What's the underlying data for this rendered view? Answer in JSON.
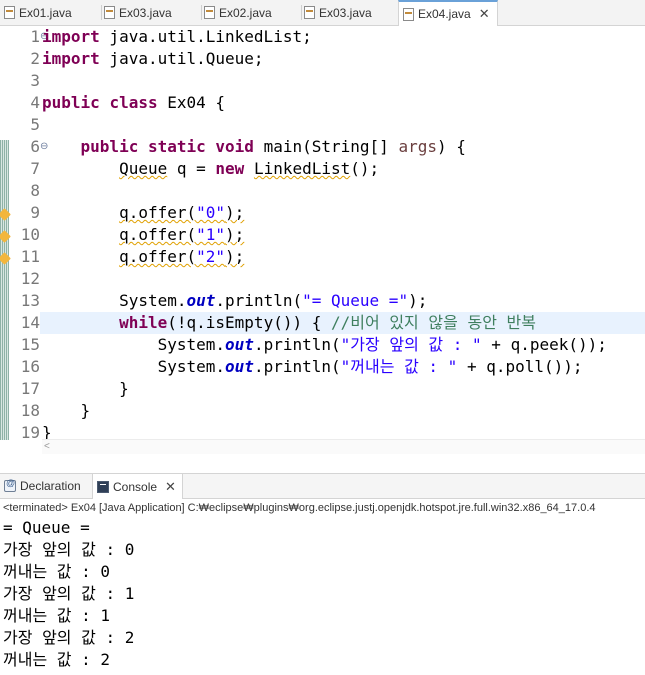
{
  "tabs": [
    {
      "label": "Ex01.java",
      "active": false
    },
    {
      "label": "Ex03.java",
      "active": false
    },
    {
      "label": "Ex02.java",
      "active": false
    },
    {
      "label": "Ex03.java",
      "active": false
    },
    {
      "label": "Ex04.java",
      "active": true
    }
  ],
  "close_glyph": "✕",
  "editor": {
    "line_numbers": [
      "1",
      "2",
      "3",
      "4",
      "5",
      "6",
      "7",
      "8",
      "9",
      "10",
      "11",
      "12",
      "13",
      "14",
      "15",
      "16",
      "17",
      "18",
      "19"
    ],
    "code": {
      "l1_kw": "import",
      "l1_rest": " java.util.LinkedList;",
      "l2_kw": "import",
      "l2_rest": " java.util.Queue;",
      "l4_kw1": "public",
      "l4_kw2": "class",
      "l4_rest": " Ex04 {",
      "l6_kw1": "public",
      "l6_kw2": "static",
      "l6_kw3": "void",
      "l6_a": " main(String[] ",
      "l6_param": "args",
      "l6_b": ") {",
      "l7_type": "Queue",
      "l7_a": " q = ",
      "l7_kw": "new",
      "l7_b": " ",
      "l7_type2": "LinkedList",
      "l7_c": "();",
      "l9_a": "q.offer(",
      "l9_str": "\"0\"",
      "l9_b": ");",
      "l10_a": "q.offer(",
      "l10_str": "\"1\"",
      "l10_b": ");",
      "l11_a": "q.offer(",
      "l11_str": "\"2\"",
      "l11_b": ");",
      "l13_a": "System.",
      "l13_fld": "out",
      "l13_b": ".println(",
      "l13_str": "\"= Queue =\"",
      "l13_c": ");",
      "l14_kw": "while",
      "l14_a": "(!q.isEmpty()) { ",
      "l14_cm": "//비어 있지 않을 동안 반복",
      "l15_a": "System.",
      "l15_fld": "out",
      "l15_b": ".println(",
      "l15_str": "\"가장 앞의 값 : \"",
      "l15_c": " + q.peek());",
      "l16_a": "System.",
      "l16_fld": "out",
      "l16_b": ".println(",
      "l16_str": "\"꺼내는 값 : \"",
      "l16_c": " + q.poll());",
      "l17": "}",
      "l18": "}",
      "l19": "}"
    }
  },
  "views": {
    "declaration_label": "Declaration",
    "console_label": "Console"
  },
  "terminated_text": "<terminated> Ex04 [Java Application] C:₩eclipse₩plugins₩org.eclipse.justj.openjdk.hotspot.jre.full.win32.x86_64_17.0.4",
  "console_output": [
    "= Queue =",
    "가장 앞의 값 : 0",
    "꺼내는 값 : 0",
    "가장 앞의 값 : 1",
    "꺼내는 값 : 1",
    "가장 앞의 값 : 2",
    "꺼내는 값 : 2"
  ],
  "icons": [
    "java-file-icon",
    "declaration-icon",
    "console-icon",
    "close-icon",
    "fold-icon",
    "warning-icon"
  ]
}
